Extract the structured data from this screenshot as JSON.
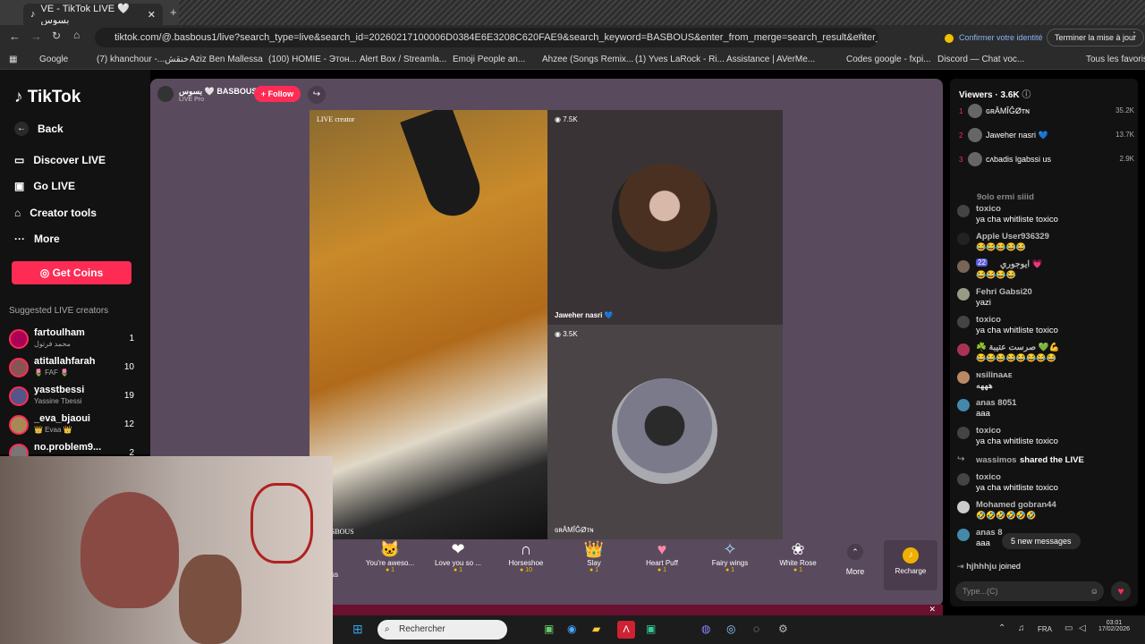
{
  "browser": {
    "tab_title": "VE - TikTok LIVE 🤍 بسوس",
    "url": "tiktok.com/@.basbous1/live?search_type=live&search_id=20260217100006D0384E6E3208C620FAE9&search_keyword=BASBOUS&enter_from_merge=search_result&enter_method=live_cell&search_...",
    "confirm_identity": "Confirmer votre identité",
    "finish_update": "Terminer la mise à jour",
    "bookmarks": [
      "Google",
      "(7) khanchour -...خنقش",
      "Aziz Ben Mallessa",
      "(100) HOMIE - Этон...",
      "Alert Box / Streamla...",
      "Emoji People an...",
      "Ahzee (Songs Remix...",
      "(1) Yves LaRock - Ri...",
      "Assistance | AVerMe...",
      "Codes google - fxpi...",
      "Discord — Chat voc...",
      "Tous les favoris"
    ]
  },
  "sidebar": {
    "logo": "TikTok",
    "back": "Back",
    "nav": [
      "Discover LIVE",
      "Go LIVE",
      "Creator tools",
      "More"
    ],
    "get_coins": "Get Coins",
    "suggested_title": "Suggested LIVE creators",
    "creators": [
      {
        "name": "fartoulham",
        "sub": "محمد فرتول",
        "count": "1"
      },
      {
        "name": "atitallahfarah",
        "sub": "🌷 FAF 🌷",
        "count": "10"
      },
      {
        "name": "yasstbessi",
        "sub": "Yassine Tbessi",
        "count": "19"
      },
      {
        "name": "_eva_bjaoui",
        "sub": "👑 Evaa 👑",
        "count": "12"
      },
      {
        "name": "no.problem9...",
        "sub": "",
        "count": "2"
      }
    ]
  },
  "host": {
    "name": "بسوس 🤍 BASBOUS",
    "sub": "LIVE Pro",
    "follow": "+ Follow"
  },
  "streams": {
    "creator_label": "LIVE creator",
    "host_tag": "BASBOUS",
    "guest1": {
      "count": "7.5K",
      "name": "Jaweher nasri 💙"
    },
    "guest2": {
      "count": "3.5K",
      "name": "ɢʀÂMÎĜØтɴ"
    }
  },
  "gifts": [
    {
      "name": "ss",
      "price": ""
    },
    {
      "name": "You're aweso...",
      "price": "1"
    },
    {
      "name": "Love you so ...",
      "price": "1"
    },
    {
      "name": "Horseshoe",
      "price": "10"
    },
    {
      "name": "Slay",
      "price": "1"
    },
    {
      "name": "Heart Puff",
      "price": "1"
    },
    {
      "name": "Fairy wings",
      "price": "1"
    },
    {
      "name": "White Rose",
      "price": "1"
    }
  ],
  "gift_more": "More",
  "recharge": "Recharge",
  "viewers": {
    "title": "Viewers · 3.6K",
    "top": [
      {
        "rank": "1",
        "name": "ɢʀÂMÎĜØтɴ",
        "score": "35.2K"
      },
      {
        "rank": "2",
        "name": "Jaweher nasri 💙",
        "score": "13.7K"
      },
      {
        "rank": "3",
        "name": "cʌbadis lgabssi us",
        "score": "2.9K"
      }
    ]
  },
  "chat": [
    {
      "name": "9olo ermi siiid",
      "text": ""
    },
    {
      "name": "toxico",
      "text": "ya cha whitliste toxico"
    },
    {
      "name": "Apple User936329",
      "text": "😂😂😂😂😂"
    },
    {
      "name": "ايوجوري 💗",
      "text": "😂😂😂😂"
    },
    {
      "name": "Fehri Gabsi20",
      "text": "yazi"
    },
    {
      "name": "toxico",
      "text": "ya cha whitliste toxico"
    },
    {
      "name": "☘️ صرست عتيبة 💚💪",
      "text": "😂😂😂😂😂😂😂😂"
    },
    {
      "name": "ɴsilinaᴀᴇ",
      "text": "هههه"
    },
    {
      "name": "anas 8051",
      "text": "aaa"
    },
    {
      "name": "toxico",
      "text": "ya cha whitliste toxico"
    },
    {
      "name": "wassimos",
      "text": "shared the LIVE"
    },
    {
      "name": "toxico",
      "text": "ya cha whitliste toxico"
    },
    {
      "name": "Mohamed gobran44",
      "text": "🤣🤣🤣🤣🤣🤣"
    },
    {
      "name": "anas 8",
      "text": "aaa"
    }
  ],
  "new_messages": "5 new messages",
  "joined": {
    "name": "hjhhhju",
    "text": "joined"
  },
  "chat_placeholder": "Type...(C)",
  "taskbar": {
    "search": "Rechercher",
    "lang": "FRA",
    "time": "03:01",
    "date": "17/02/2026"
  },
  "badge_22": "22"
}
